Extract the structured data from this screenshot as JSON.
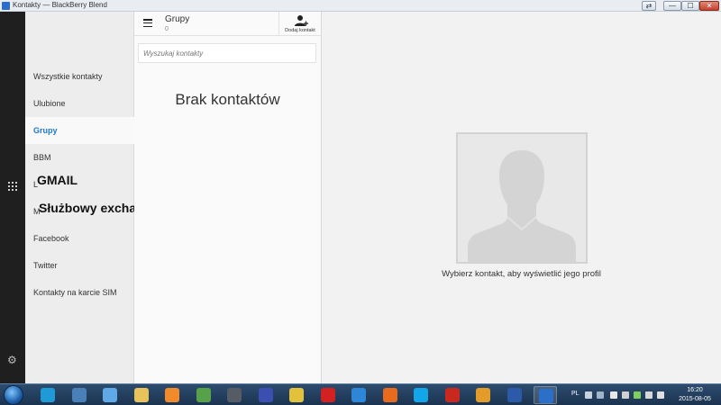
{
  "window": {
    "title": "Kontakty — BlackBerry Blend",
    "minimize_glyph": "—",
    "maximize_glyph": "☐",
    "close_glyph": "✕",
    "swap_glyph": "⇄"
  },
  "rail": {
    "apps_icon": "grid-icon",
    "settings_icon": "gear-icon"
  },
  "categories": {
    "items": [
      {
        "label": "Wszystkie kontakty",
        "active": false
      },
      {
        "label": "Ulubione",
        "active": false
      },
      {
        "label": "Grupy",
        "active": true
      },
      {
        "label": "BBM",
        "active": false
      },
      {
        "label": "L",
        "active": false
      },
      {
        "label": "M",
        "active": false
      },
      {
        "label": "Facebook",
        "active": false
      },
      {
        "label": "Twitter",
        "active": false
      },
      {
        "label": "Kontakty na karcie SIM",
        "active": false
      }
    ],
    "overlay": {
      "gmail": "GMAIL",
      "exchange": "Służbowy exchange"
    }
  },
  "contacts": {
    "title": "Grupy",
    "count": "0",
    "add_contact_label": "Dodaj kontakt",
    "search_placeholder": "Wyszukaj kontakty",
    "search_value": "",
    "empty_text": "Brak kontaktów"
  },
  "detail": {
    "hint": "Wybierz kontakt, aby wyświetlić jego profil",
    "avatar_icon": "person-silhouette-icon"
  },
  "taskbar": {
    "language": "PL",
    "time": "16:20",
    "date": "2015-08-05",
    "apps": [
      {
        "name": "kodi",
        "color": "#1f9ad6"
      },
      {
        "name": "network",
        "color": "#4a7fb8"
      },
      {
        "name": "blackberry",
        "color": "#5fa9e6"
      },
      {
        "name": "explorer",
        "color": "#e8c25a"
      },
      {
        "name": "outlook",
        "color": "#f08a2a"
      },
      {
        "name": "app-green",
        "color": "#57a14b"
      },
      {
        "name": "app-lock",
        "color": "#555c66"
      },
      {
        "name": "save",
        "color": "#3a4fb0"
      },
      {
        "name": "chrome",
        "color": "#e2c23a"
      },
      {
        "name": "opera",
        "color": "#d32121"
      },
      {
        "name": "app-x",
        "color": "#2e86d6"
      },
      {
        "name": "firefox",
        "color": "#e86a1c"
      },
      {
        "name": "skype",
        "color": "#12a6e8"
      },
      {
        "name": "pdf",
        "color": "#c8281e"
      },
      {
        "name": "app-orange",
        "color": "#e39b2a"
      },
      {
        "name": "word",
        "color": "#2b5aa8"
      },
      {
        "name": "blend",
        "color": "#2b6fc6"
      }
    ]
  },
  "colors": {
    "accent": "#1e78c8",
    "rail": "#1f1f1f",
    "taskbar": "#1b3350"
  }
}
